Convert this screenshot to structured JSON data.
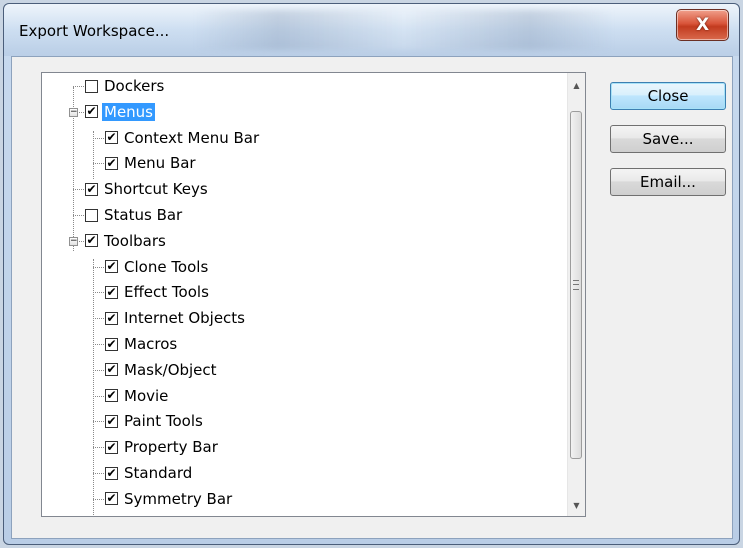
{
  "window": {
    "title": "Export Workspace...",
    "close_glyph": "X"
  },
  "tree": {
    "items": [
      {
        "label": "Dockers",
        "checked": false,
        "level": 0
      },
      {
        "label": "Menus",
        "checked": true,
        "level": 0,
        "expanded": true,
        "selected": true
      },
      {
        "label": "Context Menu Bar",
        "checked": true,
        "level": 1
      },
      {
        "label": "Menu Bar",
        "checked": true,
        "level": 1
      },
      {
        "label": "Shortcut Keys",
        "checked": true,
        "level": 0
      },
      {
        "label": "Status Bar",
        "checked": false,
        "level": 0
      },
      {
        "label": "Toolbars",
        "checked": true,
        "level": 0,
        "expanded": true
      },
      {
        "label": "Clone Tools",
        "checked": true,
        "level": 1
      },
      {
        "label": "Effect Tools",
        "checked": true,
        "level": 1
      },
      {
        "label": "Internet Objects",
        "checked": true,
        "level": 1
      },
      {
        "label": "Macros",
        "checked": true,
        "level": 1
      },
      {
        "label": "Mask/Object",
        "checked": true,
        "level": 1
      },
      {
        "label": "Movie",
        "checked": true,
        "level": 1
      },
      {
        "label": "Paint Tools",
        "checked": true,
        "level": 1
      },
      {
        "label": "Property Bar",
        "checked": true,
        "level": 1
      },
      {
        "label": "Standard",
        "checked": true,
        "level": 1
      },
      {
        "label": "Symmetry Bar",
        "checked": true,
        "level": 1
      }
    ],
    "check_glyph": "✔",
    "collapse_glyph": "−"
  },
  "buttons": {
    "close": "Close",
    "save": "Save...",
    "email": "Email..."
  },
  "scrollbar": {
    "up_glyph": "▲",
    "down_glyph": "▼"
  }
}
